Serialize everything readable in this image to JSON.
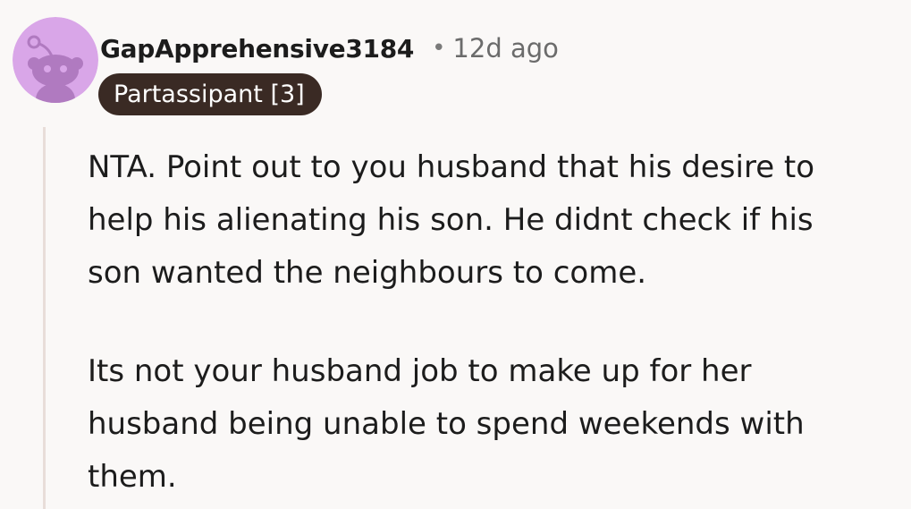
{
  "comment": {
    "author": "GapApprehensive3184",
    "separator": "•",
    "time": "12d ago",
    "flair": "Partassipant [3]",
    "avatar": {
      "icon": "reddit-snoo-icon",
      "background_color": "#d9a6e8",
      "figure_color": "#b07ac0"
    },
    "paragraphs": [
      "NTA. Point out to you husband that his desire to\nhelp his alienating his son.  He didnt check if his\nson wanted the neighbours  to come.",
      "Its not your husband job to make up for her\nhusband being unable to spend weekends with\nthem."
    ]
  }
}
